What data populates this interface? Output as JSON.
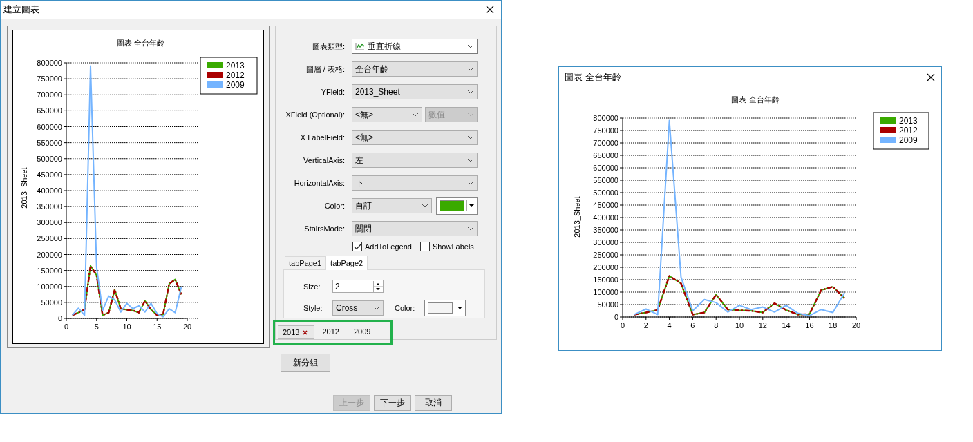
{
  "dialog": {
    "title": "建立圖表"
  },
  "preview": {
    "chart_data": {
      "type": "line",
      "title": "圖表 全台年齡",
      "ylabel": "2013_Sheet",
      "x": [
        1,
        2,
        3,
        4,
        5,
        6,
        7,
        8,
        9,
        10,
        11,
        12,
        13,
        14,
        15,
        16,
        17,
        18,
        19
      ],
      "series": [
        {
          "name": "2013",
          "color": "#3aaa00",
          "line_style": "solid",
          "values": [
            10000,
            18000,
            28000,
            165000,
            135000,
            10000,
            18000,
            90000,
            30000,
            27000,
            25000,
            18000,
            55000,
            28000,
            10000,
            12000,
            108000,
            122000,
            75000
          ]
        },
        {
          "name": "2012",
          "color": "#aa0000",
          "line_style": "dashed",
          "values": [
            10000,
            18000,
            28000,
            165000,
            135000,
            10000,
            18000,
            90000,
            30000,
            27000,
            25000,
            18000,
            55000,
            28000,
            10000,
            12000,
            108000,
            122000,
            75000
          ]
        },
        {
          "name": "2009",
          "color": "#74b4ff",
          "line_style": "solid",
          "values": [
            10000,
            32000,
            10000,
            790000,
            160000,
            25000,
            70000,
            58000,
            20000,
            47000,
            30000,
            40000,
            20000,
            47000,
            15000,
            5000,
            30000,
            18000,
            97000
          ]
        }
      ],
      "xlim": [
        0,
        20
      ],
      "ylim": [
        0,
        800000
      ],
      "xticks": [
        0,
        5,
        10,
        15,
        20
      ],
      "yticks": [
        0,
        50000,
        100000,
        150000,
        200000,
        250000,
        300000,
        350000,
        400000,
        450000,
        500000,
        550000,
        600000,
        650000,
        700000,
        750000,
        800000
      ],
      "grid": true,
      "legend": true
    }
  },
  "form": {
    "rows": [
      {
        "label": "圖表類型:",
        "kind": "icon-select",
        "value": "垂直折線"
      },
      {
        "label": "圖層 / 表格:",
        "kind": "select",
        "value": "全台年齡"
      },
      {
        "label": "YField:",
        "kind": "select",
        "value": "2013_Sheet"
      },
      {
        "label": "XField (Optional):",
        "kind": "select-pair",
        "value": "<無>",
        "second": {
          "value": "數值",
          "disabled": true
        }
      },
      {
        "label": "X LabelField:",
        "kind": "select",
        "value": "<無>"
      },
      {
        "label": "VerticalAxis:",
        "kind": "select",
        "value": "左"
      },
      {
        "label": "HorizontalAxis:",
        "kind": "select",
        "value": "下"
      },
      {
        "label": "Color:",
        "kind": "color",
        "value": "自訂",
        "color": "#3aaa00"
      },
      {
        "label": "StairsMode:",
        "kind": "select",
        "value": "關閉"
      }
    ],
    "checkboxes": [
      {
        "label": "AddToLegend",
        "checked": true
      },
      {
        "label": "ShowLabels",
        "checked": false
      }
    ],
    "tab_pages": {
      "tabs": [
        {
          "label": "tabPage1",
          "selected": false
        },
        {
          "label": "tabPage2",
          "selected": true
        }
      ],
      "size": {
        "label": "Size:",
        "value": "2"
      },
      "style": {
        "label": "Style:",
        "value": "Cross"
      },
      "color": {
        "label": "Color:",
        "color": "#f4f4f4"
      }
    }
  },
  "series_tabs": [
    {
      "label": "2013",
      "selected": true
    },
    {
      "label": "2012",
      "selected": false
    },
    {
      "label": "2009",
      "selected": false
    }
  ],
  "new_group_button": "新分組",
  "footer_buttons": [
    {
      "label": "上一步",
      "disabled": true
    },
    {
      "label": "下一步",
      "disabled": false
    },
    {
      "label": "取消",
      "disabled": false
    }
  ],
  "popup": {
    "title": "圖表 全台年齡",
    "chart_data": {
      "type": "line",
      "title": "圖表 全台年齡",
      "ylabel": "2013_Sheet",
      "x": [
        1,
        2,
        3,
        4,
        5,
        6,
        7,
        8,
        9,
        10,
        11,
        12,
        13,
        14,
        15,
        16,
        17,
        18,
        19
      ],
      "series": [
        {
          "name": "2013",
          "color": "#3aaa00",
          "line_style": "solid",
          "values": [
            10000,
            18000,
            28000,
            165000,
            135000,
            10000,
            18000,
            90000,
            30000,
            27000,
            25000,
            18000,
            55000,
            28000,
            10000,
            12000,
            108000,
            122000,
            75000
          ]
        },
        {
          "name": "2012",
          "color": "#aa0000",
          "line_style": "dashed",
          "values": [
            10000,
            18000,
            28000,
            165000,
            135000,
            10000,
            18000,
            90000,
            30000,
            27000,
            25000,
            18000,
            55000,
            28000,
            10000,
            12000,
            108000,
            122000,
            75000
          ]
        },
        {
          "name": "2009",
          "color": "#74b4ff",
          "line_style": "solid",
          "values": [
            10000,
            32000,
            10000,
            790000,
            160000,
            25000,
            70000,
            58000,
            20000,
            47000,
            30000,
            40000,
            20000,
            47000,
            15000,
            5000,
            30000,
            18000,
            97000
          ]
        }
      ],
      "xlim": [
        0,
        20
      ],
      "ylim": [
        0,
        800000
      ],
      "xticks": [
        0,
        2,
        4,
        6,
        8,
        10,
        12,
        14,
        16,
        18,
        20
      ],
      "yticks": [
        0,
        50000,
        100000,
        150000,
        200000,
        250000,
        300000,
        350000,
        400000,
        450000,
        500000,
        550000,
        600000,
        650000,
        700000,
        750000,
        800000
      ],
      "grid": true,
      "legend": true
    }
  }
}
